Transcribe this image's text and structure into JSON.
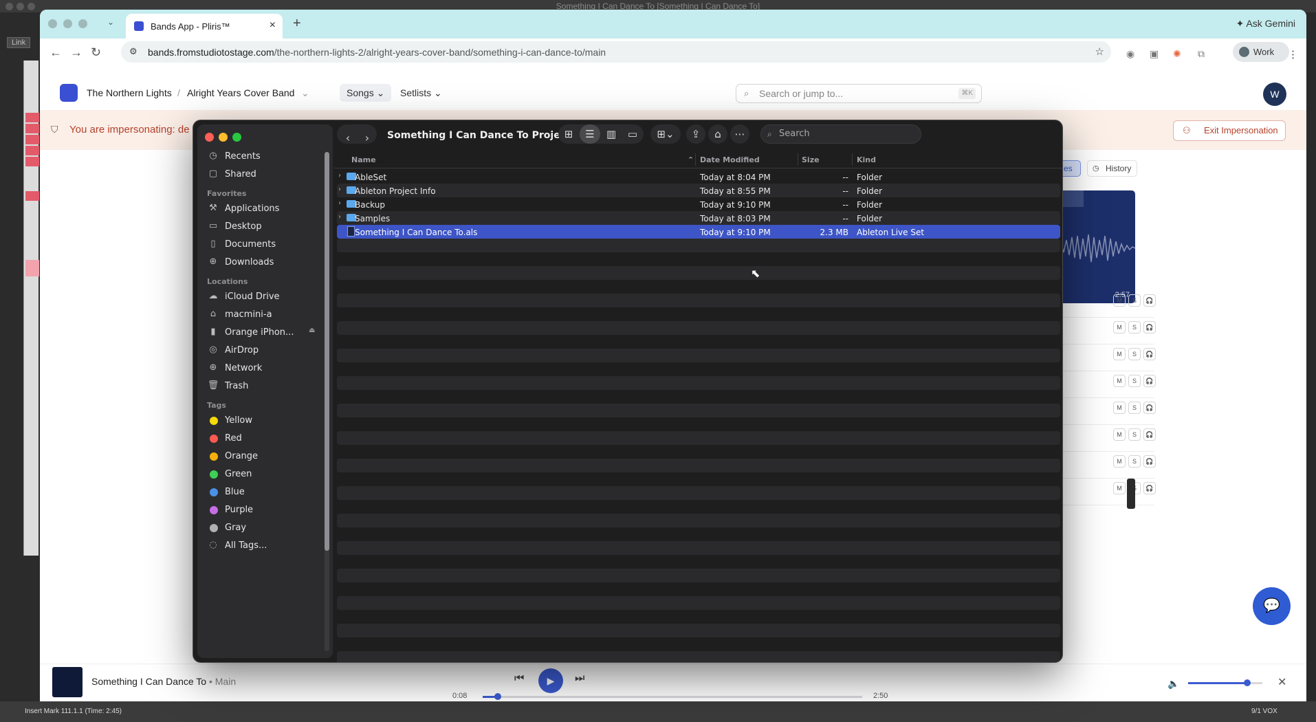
{
  "ableton": {
    "window_title": "Something I Can Dance To  [Something I Can Dance To]",
    "link_label": "Link",
    "status_text": "Insert Mark 111.1.1 (Time: 2:45)",
    "status_right": "9/1 VOX"
  },
  "browser": {
    "tab_title": "Bands App - Pliris™",
    "url_host": "bands.fromstudiotostage.com",
    "url_path": "/the-northern-lights-2/alright-years-cover-band/something-i-can-dance-to/main",
    "ask_gemini": "Ask Gemini",
    "profile": "Work"
  },
  "app": {
    "org": "The Northern Lights",
    "band": "Alright Years Cover Band",
    "nav": [
      "Songs",
      "Setlists"
    ],
    "search_placeholder": "Search or jump to...",
    "search_shortcut": "⌘K",
    "avatar_initial": "W",
    "banner_text": "You are impersonating: de",
    "exit_label": "Exit Impersonation",
    "history_label": "History",
    "blue_tab_label": "es",
    "wave_time": "2:57",
    "track_buttons": [
      "M",
      "S",
      "🎧"
    ],
    "track_count": 8
  },
  "player": {
    "song": "Something I Can Dance To",
    "version": "Main",
    "separator": "•",
    "elapsed": "0:08",
    "remaining": "2:50",
    "progress": 0.04,
    "volume": 0.8
  },
  "finder": {
    "title": "Something I Can Dance To Project",
    "search_placeholder": "Search",
    "sidebar": {
      "top": [
        {
          "label": "Recents",
          "icon": "clock-icon"
        },
        {
          "label": "Shared",
          "icon": "shared-folder-icon"
        }
      ],
      "favorites_header": "Favorites",
      "favorites": [
        {
          "label": "Applications",
          "icon": "applications-icon"
        },
        {
          "label": "Desktop",
          "icon": "desktop-icon"
        },
        {
          "label": "Documents",
          "icon": "document-icon"
        },
        {
          "label": "Downloads",
          "icon": "download-icon"
        }
      ],
      "locations_header": "Locations",
      "locations": [
        {
          "label": "iCloud Drive",
          "icon": "cloud-icon"
        },
        {
          "label": "macmini-a",
          "icon": "home-icon"
        },
        {
          "label": "Orange iPhon...",
          "icon": "phone-icon"
        },
        {
          "label": "AirDrop",
          "icon": "airdrop-icon"
        },
        {
          "label": "Network",
          "icon": "globe-icon"
        },
        {
          "label": "Trash",
          "icon": "trash-icon"
        }
      ],
      "tags_header": "Tags",
      "tags": [
        {
          "label": "Yellow",
          "color": "#f5d90a"
        },
        {
          "label": "Red",
          "color": "#ff5a52"
        },
        {
          "label": "Orange",
          "color": "#f5b10a"
        },
        {
          "label": "Green",
          "color": "#3fcf56"
        },
        {
          "label": "Blue",
          "color": "#4a90e8"
        },
        {
          "label": "Purple",
          "color": "#c56ee6"
        },
        {
          "label": "Gray",
          "color": "#b0b0b5"
        }
      ],
      "all_tags": "All Tags..."
    },
    "columns": {
      "name": "Name",
      "date": "Date Modified",
      "size": "Size",
      "kind": "Kind"
    },
    "rows": [
      {
        "name": "AbleSet",
        "date": "Today at 8:04 PM",
        "size": "--",
        "kind": "Folder",
        "type": "folder"
      },
      {
        "name": "Ableton Project Info",
        "date": "Today at 8:55 PM",
        "size": "--",
        "kind": "Folder",
        "type": "folder"
      },
      {
        "name": "Backup",
        "date": "Today at 9:10 PM",
        "size": "--",
        "kind": "Folder",
        "type": "folder"
      },
      {
        "name": "Samples",
        "date": "Today at 8:03 PM",
        "size": "--",
        "kind": "Folder",
        "type": "folder"
      },
      {
        "name": "Something I Can Dance To.als",
        "date": "Today at 9:10 PM",
        "size": "2.3 MB",
        "kind": "Ableton Live Set",
        "type": "file",
        "selected": true
      }
    ]
  }
}
